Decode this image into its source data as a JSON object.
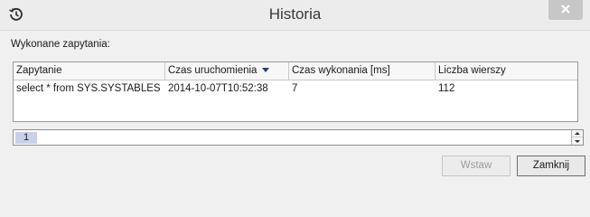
{
  "window": {
    "title": "Historia",
    "icons": {
      "title": "history-icon",
      "close": "close-icon"
    }
  },
  "main": {
    "section_label": "Wykonane zapytania:",
    "table": {
      "columns": [
        {
          "label": "Zapytanie",
          "sorted": false
        },
        {
          "label": "Czas uruchomienia",
          "sorted": true,
          "sort_direction": "descending"
        },
        {
          "label": "Czas wykonania [ms]",
          "sorted": false
        },
        {
          "label": "Liczba wierszy",
          "sorted": false
        }
      ],
      "rows": [
        [
          "select * from SYS.SYSTABLES",
          "2014-10-07T10:52:38",
          "7",
          "112"
        ]
      ]
    },
    "stepper": {
      "value": "1"
    }
  },
  "footer": {
    "insert_label": "Wstaw",
    "close_label": "Zamknij"
  },
  "colors": {
    "selection": "#c9d0ea",
    "sort_arrow": "#2c3e7a"
  }
}
